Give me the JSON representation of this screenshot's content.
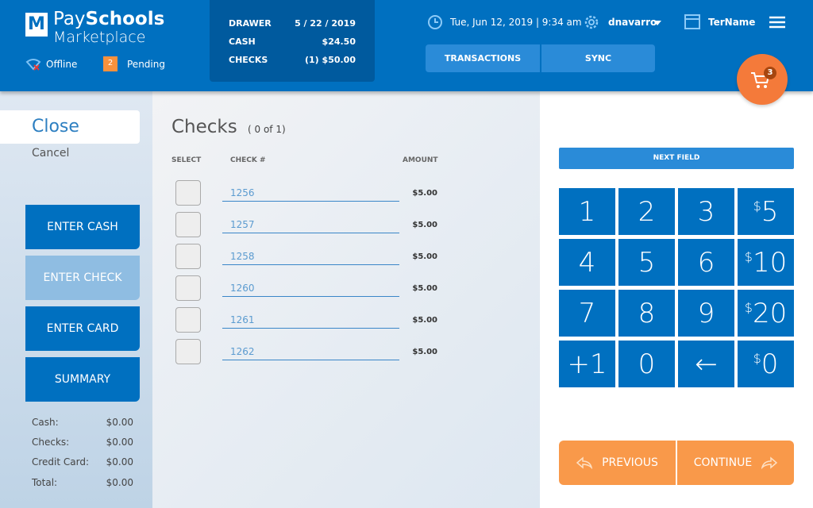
{
  "header": {
    "logo_letter": "M",
    "brand_pay": "Pay",
    "brand_schools": "Schools",
    "brand_sub": "Marketplace",
    "offline_label": "Offline",
    "pending_count": "2",
    "pending_label": "Pending",
    "drawer": {
      "rows": [
        {
          "label": "DRAWER",
          "value": "5 / 22 / 2019"
        },
        {
          "label": "CASH",
          "value": "$24.50"
        },
        {
          "label": "CHECKS",
          "value": "(1) $50.00"
        }
      ]
    },
    "datetime": "Tue, Jun 12, 2019 | 9:34 am",
    "user": "dnavarro",
    "terminal": "TerName",
    "tabs": [
      "TRANSACTIONS",
      "SYNC"
    ],
    "cart_count": "3"
  },
  "sidebar": {
    "close": "Close",
    "cancel": "Cancel",
    "buttons": [
      "ENTER CASH",
      "ENTER CHECK",
      "ENTER CARD",
      "SUMMARY"
    ],
    "active_button": "ENTER CHECK",
    "summary": [
      {
        "label": "Cash:",
        "value": "$0.00"
      },
      {
        "label": "Checks:",
        "value": "$0.00"
      },
      {
        "label": "Credit Card:",
        "value": "$0.00"
      },
      {
        "label": "Total:",
        "value": "$0.00"
      }
    ]
  },
  "checks": {
    "title": "Checks",
    "count": "( 0 of 1)",
    "columns": [
      "SELECT",
      "CHECK #",
      "AMOUNT"
    ],
    "rows": [
      {
        "check": "1256",
        "amount": "$5.00"
      },
      {
        "check": "1257",
        "amount": "$5.00"
      },
      {
        "check": "1258",
        "amount": "$5.00"
      },
      {
        "check": "1260",
        "amount": "$5.00"
      },
      {
        "check": "1261",
        "amount": "$5.00"
      },
      {
        "check": "1262",
        "amount": "$5.00"
      }
    ]
  },
  "keypad": {
    "next_field": "NEXT FIELD",
    "keys": [
      [
        "1",
        "",
        ""
      ],
      [
        "2",
        "",
        ""
      ],
      [
        "3",
        "",
        ""
      ],
      [
        "5",
        "$",
        ""
      ],
      [
        "4",
        "",
        ""
      ],
      [
        "5",
        "",
        ""
      ],
      [
        "6",
        "",
        ""
      ],
      [
        "10",
        "$",
        ""
      ],
      [
        "7",
        "",
        ""
      ],
      [
        "8",
        "",
        ""
      ],
      [
        "9",
        "",
        ""
      ],
      [
        "20",
        "$",
        ""
      ],
      [
        "+1",
        "",
        ""
      ],
      [
        "0",
        "",
        ""
      ],
      [
        "←",
        "",
        ""
      ],
      [
        "0",
        "$",
        ""
      ]
    ]
  },
  "nav": {
    "previous": "PREVIOUS",
    "continue": "CONTINUE"
  },
  "colors": {
    "primary": "#0070c0",
    "accent": "#f9994a",
    "cart": "#f47a3a"
  }
}
